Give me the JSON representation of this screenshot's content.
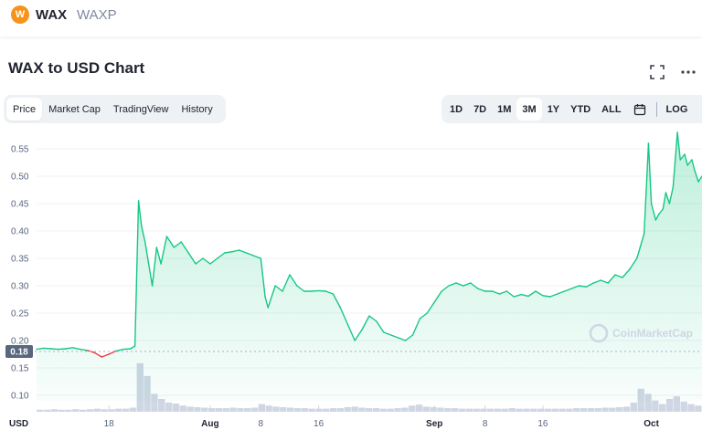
{
  "header": {
    "coin_name": "WAX",
    "coin_symbol": "WAXP",
    "logo_glyph": "W"
  },
  "title": "WAX to USD Chart",
  "icons": {
    "fullscreen": "fullscreen-icon",
    "more": "more-icon",
    "calendar": "calendar-icon"
  },
  "tabs": [
    {
      "label": "Price",
      "active": true
    },
    {
      "label": "Market Cap",
      "active": false
    },
    {
      "label": "TradingView",
      "active": false
    },
    {
      "label": "History",
      "active": false
    }
  ],
  "ranges": [
    {
      "label": "1D",
      "active": false
    },
    {
      "label": "7D",
      "active": false
    },
    {
      "label": "1M",
      "active": false
    },
    {
      "label": "3M",
      "active": true
    },
    {
      "label": "1Y",
      "active": false
    },
    {
      "label": "YTD",
      "active": false
    },
    {
      "label": "ALL",
      "active": false
    }
  ],
  "log_label": "LOG",
  "watermark": "CoinMarketCap",
  "colors": {
    "up": "#16c784",
    "down": "#ea3943",
    "volume": "#cfd6e4",
    "accent_logo": "#f7931a"
  },
  "chart_data": {
    "type": "line",
    "currency_label": "USD",
    "y_ticks": [
      "0.55",
      "0.50",
      "0.45",
      "0.40",
      "0.35",
      "0.30",
      "0.25",
      "0.20",
      "0.15",
      "0.10"
    ],
    "ylim": [
      0.09,
      0.575
    ],
    "reference_value": 0.18,
    "reference_label": "0.18",
    "x_ticks": [
      {
        "label": "18",
        "bold": false,
        "t": 10
      },
      {
        "label": "Aug",
        "bold": true,
        "t": 24
      },
      {
        "label": "8",
        "bold": false,
        "t": 31
      },
      {
        "label": "16",
        "bold": false,
        "t": 39
      },
      {
        "label": "Sep",
        "bold": true,
        "t": 55
      },
      {
        "label": "8",
        "bold": false,
        "t": 62
      },
      {
        "label": "16",
        "bold": false,
        "t": 70
      },
      {
        "label": "Oct",
        "bold": true,
        "t": 85
      }
    ],
    "x_range": [
      0,
      92
    ],
    "series": [
      {
        "points": [
          [
            0,
            0.184
          ],
          [
            1,
            0.186
          ],
          [
            2,
            0.185
          ],
          [
            3,
            0.184
          ],
          [
            4,
            0.185
          ],
          [
            5,
            0.187
          ],
          [
            6,
            0.184
          ],
          [
            7,
            0.182
          ],
          [
            8,
            0.178
          ],
          [
            9,
            0.17
          ],
          [
            10,
            0.175
          ],
          [
            11,
            0.181
          ],
          [
            12,
            0.184
          ],
          [
            13,
            0.185
          ],
          [
            13.6,
            0.19
          ],
          [
            14.1,
            0.455
          ],
          [
            14.5,
            0.41
          ],
          [
            15,
            0.38
          ],
          [
            15.5,
            0.34
          ],
          [
            16,
            0.3
          ],
          [
            16.6,
            0.37
          ],
          [
            17.2,
            0.34
          ],
          [
            18,
            0.39
          ],
          [
            19,
            0.37
          ],
          [
            20,
            0.38
          ],
          [
            21,
            0.36
          ],
          [
            22,
            0.34
          ],
          [
            23,
            0.35
          ],
          [
            24,
            0.34
          ],
          [
            25,
            0.35
          ],
          [
            26,
            0.36
          ],
          [
            27,
            0.362
          ],
          [
            28,
            0.365
          ],
          [
            29,
            0.36
          ],
          [
            30,
            0.355
          ],
          [
            31,
            0.35
          ],
          [
            31.6,
            0.28
          ],
          [
            32,
            0.26
          ],
          [
            33,
            0.3
          ],
          [
            34,
            0.29
          ],
          [
            35,
            0.32
          ],
          [
            36,
            0.3
          ],
          [
            37,
            0.29
          ],
          [
            38,
            0.29
          ],
          [
            39,
            0.291
          ],
          [
            40,
            0.29
          ],
          [
            41,
            0.285
          ],
          [
            42,
            0.26
          ],
          [
            43,
            0.23
          ],
          [
            44,
            0.2
          ],
          [
            45,
            0.22
          ],
          [
            46,
            0.245
          ],
          [
            47,
            0.235
          ],
          [
            48,
            0.215
          ],
          [
            49,
            0.21
          ],
          [
            50,
            0.205
          ],
          [
            51,
            0.2
          ],
          [
            52,
            0.21
          ],
          [
            53,
            0.24
          ],
          [
            54,
            0.25
          ],
          [
            55,
            0.27
          ],
          [
            56,
            0.29
          ],
          [
            57,
            0.3
          ],
          [
            58,
            0.305
          ],
          [
            59,
            0.3
          ],
          [
            60,
            0.305
          ],
          [
            61,
            0.295
          ],
          [
            62,
            0.29
          ],
          [
            63,
            0.29
          ],
          [
            64,
            0.285
          ],
          [
            65,
            0.29
          ],
          [
            66,
            0.28
          ],
          [
            67,
            0.284
          ],
          [
            68,
            0.281
          ],
          [
            69,
            0.29
          ],
          [
            70,
            0.282
          ],
          [
            71,
            0.28
          ],
          [
            72,
            0.285
          ],
          [
            73,
            0.29
          ],
          [
            74,
            0.295
          ],
          [
            75,
            0.3
          ],
          [
            76,
            0.298
          ],
          [
            77,
            0.305
          ],
          [
            78,
            0.31
          ],
          [
            79,
            0.305
          ],
          [
            80,
            0.32
          ],
          [
            81,
            0.315
          ],
          [
            82,
            0.33
          ],
          [
            83,
            0.35
          ],
          [
            84,
            0.395
          ],
          [
            84.6,
            0.56
          ],
          [
            85,
            0.45
          ],
          [
            85.6,
            0.42
          ],
          [
            86,
            0.43
          ],
          [
            86.6,
            0.44
          ],
          [
            87,
            0.47
          ],
          [
            87.5,
            0.45
          ],
          [
            88,
            0.48
          ],
          [
            88.6,
            0.58
          ],
          [
            89,
            0.53
          ],
          [
            89.6,
            0.54
          ],
          [
            90,
            0.52
          ],
          [
            90.6,
            0.53
          ],
          [
            91,
            0.51
          ],
          [
            91.5,
            0.49
          ],
          [
            92,
            0.5
          ]
        ]
      }
    ],
    "volume": [
      0.04,
      0.04,
      0.05,
      0.04,
      0.04,
      0.05,
      0.04,
      0.05,
      0.06,
      0.05,
      0.05,
      0.06,
      0.06,
      0.08,
      0.95,
      0.7,
      0.35,
      0.25,
      0.18,
      0.16,
      0.12,
      0.1,
      0.09,
      0.08,
      0.07,
      0.07,
      0.07,
      0.08,
      0.07,
      0.07,
      0.08,
      0.15,
      0.12,
      0.1,
      0.09,
      0.08,
      0.07,
      0.07,
      0.06,
      0.06,
      0.06,
      0.07,
      0.07,
      0.09,
      0.1,
      0.08,
      0.07,
      0.07,
      0.06,
      0.06,
      0.07,
      0.08,
      0.12,
      0.14,
      0.1,
      0.09,
      0.08,
      0.07,
      0.07,
      0.06,
      0.06,
      0.06,
      0.06,
      0.06,
      0.06,
      0.06,
      0.07,
      0.06,
      0.06,
      0.06,
      0.06,
      0.06,
      0.06,
      0.06,
      0.06,
      0.07,
      0.07,
      0.07,
      0.07,
      0.08,
      0.08,
      0.09,
      0.1,
      0.18,
      0.45,
      0.35,
      0.22,
      0.15,
      0.25,
      0.3,
      0.2,
      0.15,
      0.12
    ]
  }
}
